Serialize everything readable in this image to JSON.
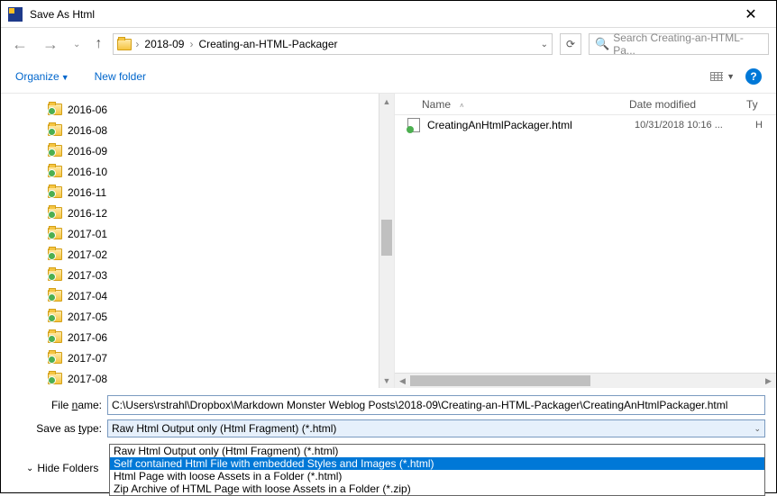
{
  "window": {
    "title": "Save As Html"
  },
  "nav": {
    "crumbs": [
      "2018-09",
      "Creating-an-HTML-Packager"
    ],
    "search_placeholder": "Search Creating-an-HTML-Pa..."
  },
  "toolbar": {
    "organize": "Organize",
    "new_folder": "New folder"
  },
  "tree": {
    "items": [
      "2016-06",
      "2016-08",
      "2016-09",
      "2016-10",
      "2016-11",
      "2016-12",
      "2017-01",
      "2017-02",
      "2017-03",
      "2017-04",
      "2017-05",
      "2017-06",
      "2017-07",
      "2017-08"
    ]
  },
  "columns": {
    "name": "Name",
    "date": "Date modified",
    "type": "Ty"
  },
  "files": [
    {
      "name": "CreatingAnHtmlPackager.html",
      "date": "10/31/2018 10:16 ...",
      "type": "H"
    }
  ],
  "fields": {
    "filename_label": "File name:",
    "filename_value": "C:\\Users\\rstrahl\\Dropbox\\Markdown Monster Weblog Posts\\2018-09\\Creating-an-HTML-Packager\\CreatingAnHtmlPackager.html",
    "savetype_label": "Save as type:",
    "savetype_value": "Raw Html Output only (Html Fragment) (*.html)"
  },
  "dropdown": [
    "Raw Html Output only (Html Fragment) (*.html)",
    "Self contained Html File with embedded Styles and Images (*.html)",
    "Html Page with loose Assets in a Folder (*.html)",
    "Zip Archive of HTML Page  with loose Assets in a Folder (*.zip)"
  ],
  "dropdown_selected": 1,
  "footer": {
    "hide_folders": "Hide Folders"
  }
}
